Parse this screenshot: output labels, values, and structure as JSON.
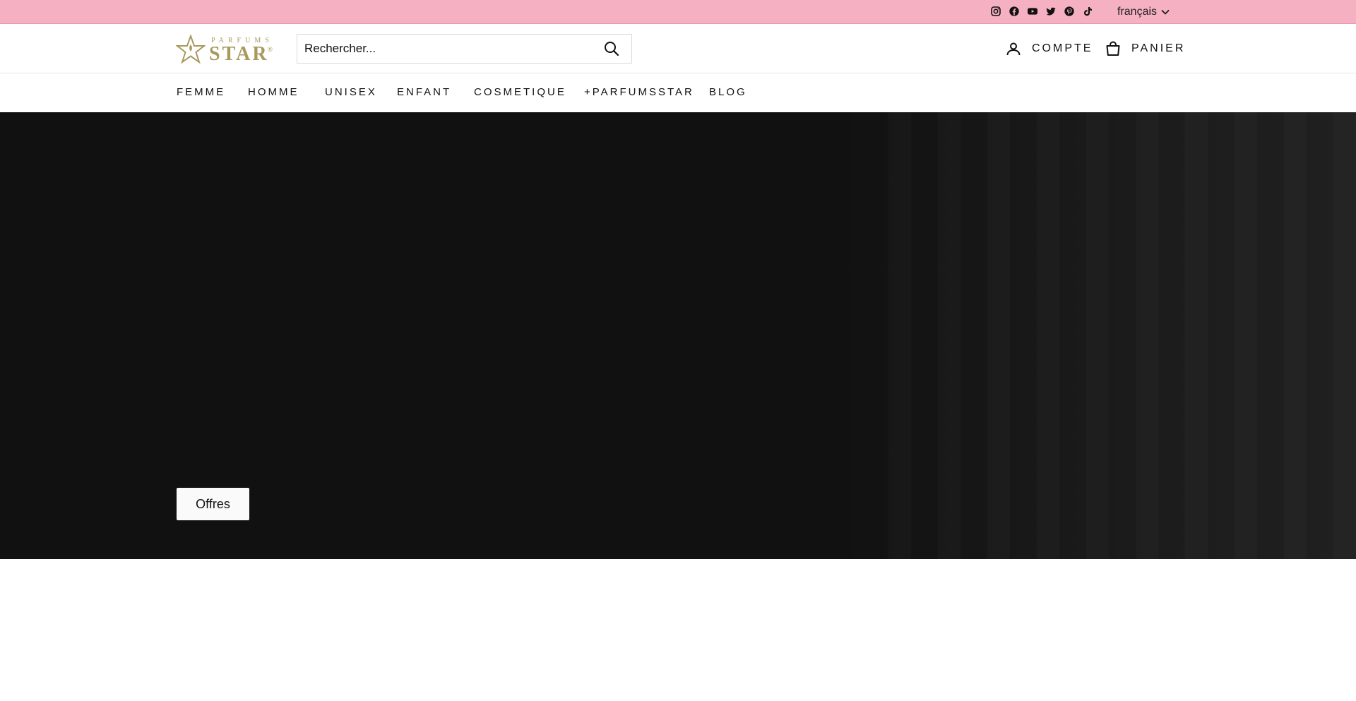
{
  "topbar": {
    "background": "#f5b0c2",
    "socials": [
      {
        "icon": "instagram-icon"
      },
      {
        "icon": "facebook-icon"
      },
      {
        "icon": "youtube-icon"
      },
      {
        "icon": "twitter-icon"
      },
      {
        "icon": "pinterest-icon"
      },
      {
        "icon": "tiktok-icon"
      }
    ],
    "language": "français"
  },
  "header": {
    "logo_top": "PARFUMS",
    "logo_main": "STAR",
    "logo_reg": "®",
    "logo_color": "#a89a5c",
    "search_placeholder": "Rechercher...",
    "account_label": "COMPTE",
    "cart_label": "PANIER"
  },
  "nav": {
    "items": [
      "FEMME",
      "HOMME",
      "UNISEX",
      "ENFANT",
      "COSMETIQUE",
      "+PARFUMSSTAR",
      "BLOG"
    ]
  },
  "hero": {
    "background": "#111111",
    "button_label": "Offres"
  }
}
